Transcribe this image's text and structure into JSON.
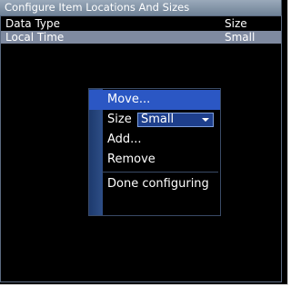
{
  "window": {
    "title": "Configure Item Locations And Sizes"
  },
  "table": {
    "headers": [
      "Data Type",
      "Size"
    ],
    "rows": [
      {
        "data_type": "Local Time",
        "size": "Small"
      }
    ]
  },
  "context_menu": {
    "items": {
      "move": "Move...",
      "size_label": "Size",
      "size_value": "Small",
      "add": "Add...",
      "remove": "Remove",
      "done": "Done configuring"
    }
  },
  "colors": {
    "titlebar": "#8394a8",
    "selected_row": "#7f8aa0",
    "menu_highlight": "#2b57c4",
    "menu_gutter": "#2e4e86"
  },
  "icons": {
    "size_dropdown": "chevron-down-icon"
  }
}
